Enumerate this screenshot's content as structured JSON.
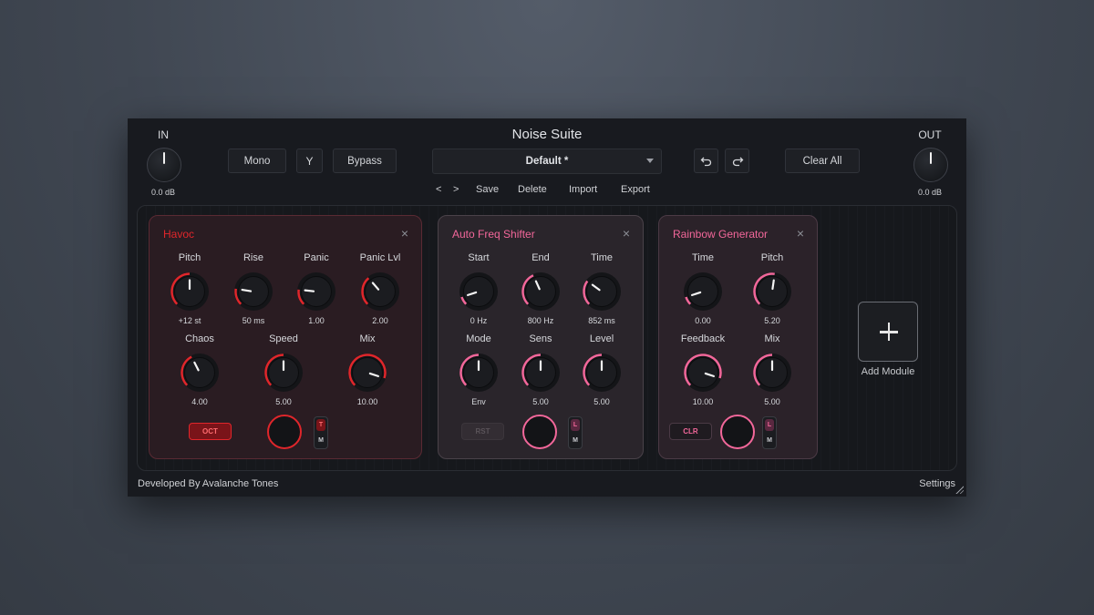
{
  "app": {
    "title": "Noise Suite"
  },
  "io": {
    "in_label": "IN",
    "in_value": "0.0 dB",
    "out_label": "OUT",
    "out_value": "0.0 dB"
  },
  "toolbar": {
    "mono": "Mono",
    "fork_icon": "Y",
    "bypass": "Bypass",
    "preset": "Default *",
    "undo_icon": "undo-icon",
    "redo_icon": "redo-icon",
    "clear_all": "Clear All"
  },
  "preset_links": {
    "prev": "<",
    "next": ">",
    "save": "Save",
    "delete": "Delete",
    "import": "Import",
    "export": "Export"
  },
  "colors": {
    "havoc": "#e0262b",
    "accent_pink": "#f2679a",
    "panel_bg": "#181a1f"
  },
  "modules": [
    {
      "title": "Havoc",
      "close": "×",
      "params": [
        {
          "label": "Pitch",
          "value": "+12 st"
        },
        {
          "label": "Rise",
          "value": "50 ms"
        },
        {
          "label": "Panic",
          "value": "1.00"
        },
        {
          "label": "Panic Lvl",
          "value": "2.00"
        },
        {
          "label": "Chaos",
          "value": "4.00"
        },
        {
          "label": "Speed",
          "value": "5.00"
        },
        {
          "label": "Mix",
          "value": "10.00"
        }
      ],
      "button": "OCT",
      "toggle_top": "T",
      "toggle_bottom": "M"
    },
    {
      "title": "Auto Freq Shifter",
      "close": "×",
      "params": [
        {
          "label": "Start",
          "value": "0 Hz"
        },
        {
          "label": "End",
          "value": "800 Hz"
        },
        {
          "label": "Time",
          "value": "852 ms"
        },
        {
          "label": "Mode",
          "value": "Env"
        },
        {
          "label": "Sens",
          "value": "5.00"
        },
        {
          "label": "Level",
          "value": "5.00"
        }
      ],
      "button": "RST",
      "toggle_top": "L",
      "toggle_bottom": "M"
    },
    {
      "title": "Rainbow Generator",
      "close": "×",
      "params": [
        {
          "label": "Time",
          "value": "0.00"
        },
        {
          "label": "Pitch",
          "value": "5.20"
        },
        {
          "label": "Feedback",
          "value": "10.00"
        },
        {
          "label": "Mix",
          "value": "5.00"
        }
      ],
      "button": "CLR",
      "toggle_top": "L",
      "toggle_bottom": "M"
    }
  ],
  "add_module": "Add Module",
  "footer": {
    "developer": "Developed By Avalanche Tones",
    "settings": "Settings"
  }
}
